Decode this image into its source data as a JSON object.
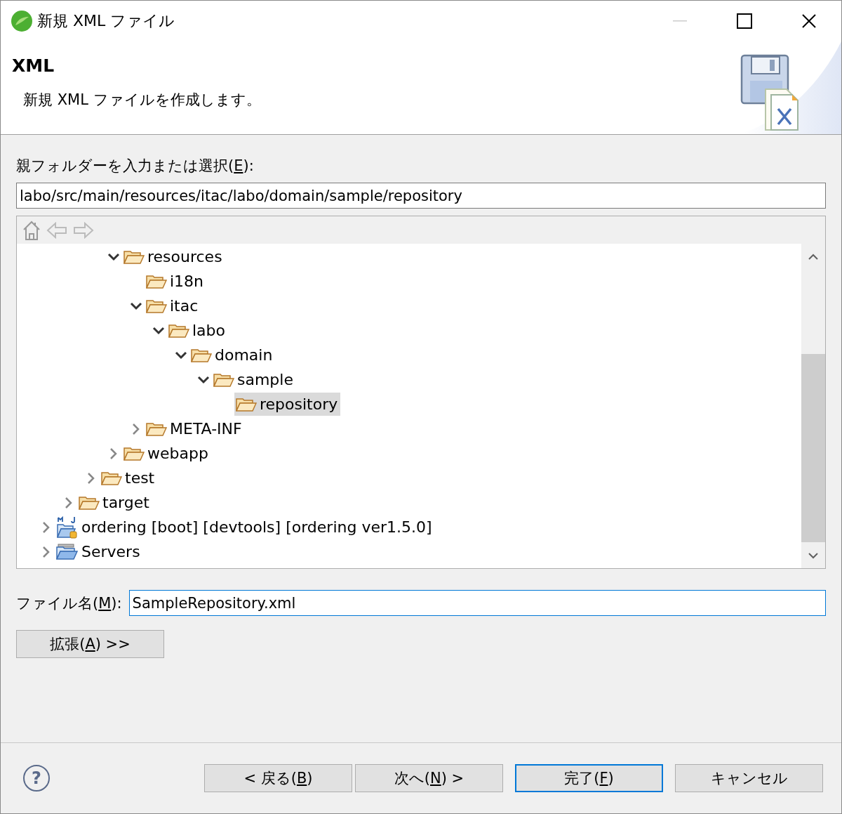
{
  "window": {
    "title": "新規 XML ファイル"
  },
  "header": {
    "title": "XML",
    "description": "新規 XML ファイルを作成します。"
  },
  "parent_folder": {
    "label": [
      "親フォルダーを入力または選択(",
      "E",
      "):"
    ],
    "value": "labo/src/main/resources/itac/labo/domain/sample/repository"
  },
  "tree": {
    "items": [
      {
        "children": [
          {
            "children": [
              {
                "children": [
                  {
                    "label": "resources",
                    "kind": "folder",
                    "expanded": true,
                    "selected": false,
                    "children": [
                      {
                        "label": "i18n",
                        "kind": "folder",
                        "selected": false
                      },
                      {
                        "label": "itac",
                        "kind": "folder",
                        "expanded": true,
                        "selected": false,
                        "children": [
                          {
                            "label": "labo",
                            "kind": "folder",
                            "expanded": true,
                            "selected": false,
                            "children": [
                              {
                                "label": "domain",
                                "kind": "folder",
                                "expanded": true,
                                "selected": false,
                                "children": [
                                  {
                                    "label": "sample",
                                    "kind": "folder",
                                    "expanded": true,
                                    "selected": false,
                                    "children": [
                                      {
                                        "label": "repository",
                                        "kind": "folder",
                                        "selected": true
                                      }
                                    ]
                                  }
                                ]
                              }
                            ]
                          }
                        ]
                      },
                      {
                        "label": "META-INF",
                        "kind": "folder",
                        "expanded": false,
                        "selected": false
                      }
                    ]
                  },
                  {
                    "label": "webapp",
                    "kind": "folder",
                    "expanded": false,
                    "selected": false
                  }
                ]
              },
              {
                "label": "test",
                "kind": "folder",
                "expanded": false,
                "selected": false
              }
            ]
          },
          {
            "label": "target",
            "kind": "folder",
            "expanded": false,
            "selected": false
          }
        ]
      },
      {
        "label": "ordering [boot] [devtools] [ordering ver1.5.0]",
        "kind": "project",
        "expanded": false,
        "selected": false
      },
      {
        "label": "Servers",
        "kind": "servers",
        "expanded": false,
        "selected": false
      }
    ]
  },
  "file_name": {
    "label": [
      "ファイル名(",
      "M",
      "):"
    ],
    "value": "SampleRepository.xml"
  },
  "advanced_button": {
    "label": [
      "拡張(",
      "A",
      ") >>"
    ]
  },
  "help": "?",
  "buttons": [
    {
      "label": [
        "< 戻る(",
        "B",
        ")"
      ],
      "default": false
    },
    {
      "label": [
        "次へ(",
        "N",
        ") >"
      ],
      "default": false
    },
    {
      "label": [
        "完了(",
        "F",
        ")"
      ],
      "default": true
    },
    {
      "label": [
        "キャンセル"
      ],
      "default": false
    }
  ]
}
